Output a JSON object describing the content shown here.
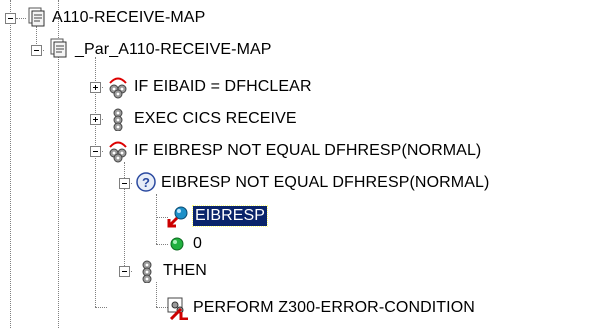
{
  "tree": {
    "nodes": [
      {
        "label": "A110-RECEIVE-MAP",
        "icon": "document-stack-icon",
        "expanded": true
      },
      {
        "label": "_Par_A110-RECEIVE-MAP",
        "icon": "document-stack-icon",
        "expanded": true
      },
      {
        "label": "IF EIBAID = DFHCLEAR",
        "icon": "if-branch-gears-icon",
        "expanded": false
      },
      {
        "label": "EXEC CICS RECEIVE",
        "icon": "gears-icon",
        "expanded": false
      },
      {
        "label": "IF EIBRESP NOT EQUAL DFHRESP(NORMAL)",
        "icon": "if-branch-gears-icon",
        "expanded": true
      },
      {
        "label": "EIBRESP NOT EQUAL DFHRESP(NORMAL)",
        "icon": "question-condition-icon",
        "expanded": true
      },
      {
        "label": "EIBRESP",
        "icon": "variable-reference-icon",
        "selected": true
      },
      {
        "label": "0",
        "icon": "constant-dot-icon"
      },
      {
        "label": "THEN",
        "icon": "gears-icon",
        "expanded": true
      },
      {
        "label": "PERFORM Z300-ERROR-CONDITION",
        "icon": "perform-call-icon"
      }
    ]
  },
  "colors": {
    "selection_bg": "#0a246a",
    "selection_text": "#ffffff",
    "tree_lines": "#808080"
  }
}
